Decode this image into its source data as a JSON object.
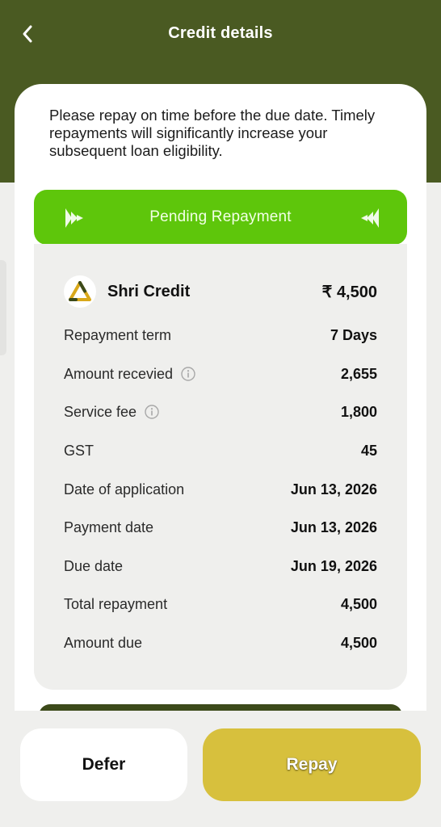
{
  "header": {
    "title": "Credit details",
    "back_icon": "chevron-left-icon"
  },
  "notice": "Please repay on time before the due date. Timely repayments will significantly increase your subsequent loan eligibility.",
  "status_banner": {
    "label": "Pending Repayment",
    "color": "#5ec60b"
  },
  "lender": {
    "name": "Shri Credit",
    "amount": "₹ 4,500",
    "logo_icon": "triangle-logo-icon"
  },
  "details": [
    {
      "label": "Repayment term",
      "value": "7 Days",
      "info": false
    },
    {
      "label": "Amount recevied",
      "value": "2,655",
      "info": true
    },
    {
      "label": "Service fee",
      "value": "1,800",
      "info": true
    },
    {
      "label": "GST",
      "value": "45",
      "info": false
    },
    {
      "label": "Date of application",
      "value": "Jun 13, 2026",
      "info": false
    },
    {
      "label": "Payment date",
      "value": "Jun 13, 2026",
      "info": false
    },
    {
      "label": "Due date",
      "value": "Jun 19, 2026",
      "info": false
    },
    {
      "label": "Total repayment",
      "value": "4,500",
      "info": false
    },
    {
      "label": "Amount due",
      "value": "4,500",
      "info": false
    }
  ],
  "actions": {
    "defer_label": "Defer",
    "repay_label": "Repay"
  },
  "colors": {
    "header_bg": "#4a5a22",
    "repay_bg": "#d7c03d",
    "page_bg": "#efefed"
  }
}
